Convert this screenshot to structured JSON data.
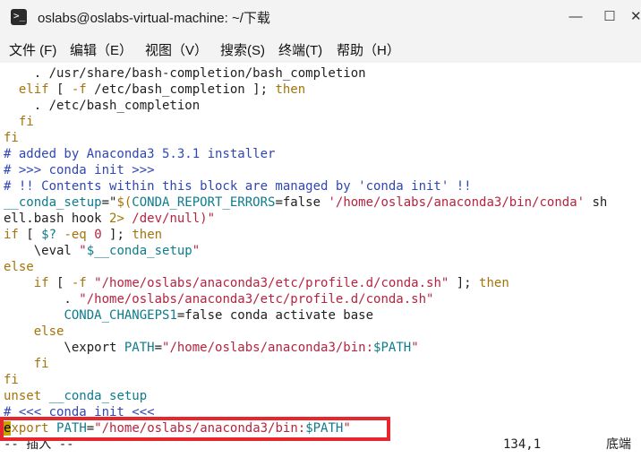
{
  "window": {
    "icon_glyph": ">_",
    "title": "oslabs@oslabs-virtual-machine: ~/下载",
    "minimize_glyph": "—",
    "maximize_glyph": "☐",
    "close_glyph": "✕"
  },
  "menu": {
    "items": [
      "文件 (F)",
      "编辑（E）",
      "视图（V）",
      "搜索(S)",
      "终端(T)",
      "帮助（H）"
    ]
  },
  "editor": {
    "lines": [
      [
        {
          "t": "    . /usr/share/bash-completion/bash_completion"
        }
      ],
      [
        {
          "t": "  "
        },
        {
          "t": "elif",
          "c": "kw"
        },
        {
          "t": " [ "
        },
        {
          "t": "-f",
          "c": "kw"
        },
        {
          "t": " /etc/bash_completion ]; "
        },
        {
          "t": "then",
          "c": "kw"
        }
      ],
      [
        {
          "t": "    . /etc/bash_completion"
        }
      ],
      [
        {
          "t": "  "
        },
        {
          "t": "fi",
          "c": "kw"
        }
      ],
      [
        {
          "t": "fi",
          "c": "kw"
        }
      ],
      [
        {
          "t": "# added by Anaconda3 5.3.1 installer",
          "c": "cmt"
        }
      ],
      [
        {
          "t": "# >>> conda init >>>",
          "c": "cmt"
        }
      ],
      [
        {
          "t": "# !! Contents within this block are managed by 'conda init' !!",
          "c": "cmt"
        }
      ],
      [
        {
          "t": "__conda_setup",
          "c": "var"
        },
        {
          "t": "=\""
        },
        {
          "t": "$(",
          "c": "kw"
        },
        {
          "t": "CONDA_REPORT_ERRORS",
          "c": "var"
        },
        {
          "t": "=false "
        },
        {
          "t": "'/home/oslabs/anaconda3/bin/conda'",
          "c": "str"
        },
        {
          "t": " sh"
        }
      ],
      [
        {
          "t": "ell.bash hook "
        },
        {
          "t": "2>",
          "c": "kw"
        },
        {
          "t": " /dev/null)\"",
          "c": "str"
        }
      ],
      [
        {
          "t": "if",
          "c": "kw"
        },
        {
          "t": " [ "
        },
        {
          "t": "$?",
          "c": "var"
        },
        {
          "t": " "
        },
        {
          "t": "-eq",
          "c": "kw"
        },
        {
          "t": " "
        },
        {
          "t": "0",
          "c": "num"
        },
        {
          "t": " ]; "
        },
        {
          "t": "then",
          "c": "kw"
        }
      ],
      [
        {
          "t": "    \\eval "
        },
        {
          "t": "\"",
          "c": "str"
        },
        {
          "t": "$__conda_setup",
          "c": "var"
        },
        {
          "t": "\"",
          "c": "str"
        }
      ],
      [
        {
          "t": "else",
          "c": "kw"
        }
      ],
      [
        {
          "t": "    "
        },
        {
          "t": "if",
          "c": "kw"
        },
        {
          "t": " [ "
        },
        {
          "t": "-f",
          "c": "kw"
        },
        {
          "t": " "
        },
        {
          "t": "\"/home/oslabs/anaconda3/etc/profile.d/conda.sh\"",
          "c": "str"
        },
        {
          "t": " ]; "
        },
        {
          "t": "then",
          "c": "kw"
        }
      ],
      [
        {
          "t": "        . "
        },
        {
          "t": "\"/home/oslabs/anaconda3/etc/profile.d/conda.sh\"",
          "c": "str"
        }
      ],
      [
        {
          "t": "        "
        },
        {
          "t": "CONDA_CHANGEPS1",
          "c": "var"
        },
        {
          "t": "=false conda activate base"
        }
      ],
      [
        {
          "t": "    "
        },
        {
          "t": "else",
          "c": "kw"
        }
      ],
      [
        {
          "t": "        \\export "
        },
        {
          "t": "PATH",
          "c": "var"
        },
        {
          "t": "="
        },
        {
          "t": "\"/home/oslabs/anaconda3/bin:",
          "c": "str"
        },
        {
          "t": "$PATH",
          "c": "var"
        },
        {
          "t": "\"",
          "c": "str"
        }
      ],
      [
        {
          "t": "    "
        },
        {
          "t": "fi",
          "c": "kw"
        }
      ],
      [
        {
          "t": "fi",
          "c": "kw"
        }
      ],
      [
        {
          "t": "unset",
          "c": "kw"
        },
        {
          "t": " "
        },
        {
          "t": "__conda_setup",
          "c": "var"
        }
      ],
      [
        {
          "t": "# <<< conda init <<<",
          "c": "cmt"
        }
      ],
      [
        {
          "t": "e",
          "c": "cursor"
        },
        {
          "t": "xport",
          "c": "kw"
        },
        {
          "t": " "
        },
        {
          "t": "PATH",
          "c": "var"
        },
        {
          "t": "="
        },
        {
          "t": "\"/home/oslabs/anaconda3/bin:",
          "c": "str"
        },
        {
          "t": "$PATH",
          "c": "var"
        },
        {
          "t": "\"",
          "c": "str"
        }
      ]
    ],
    "status_mode": "-- 插入 --",
    "status_position": "134,1",
    "status_scroll": "底端",
    "colors": {
      "keyword": "#a3740a",
      "string": "#b5243f",
      "variable": "#0e7c8c",
      "comment": "#3047b3",
      "highlight_box": "#e8262d",
      "cursor": "#c9a300"
    }
  }
}
